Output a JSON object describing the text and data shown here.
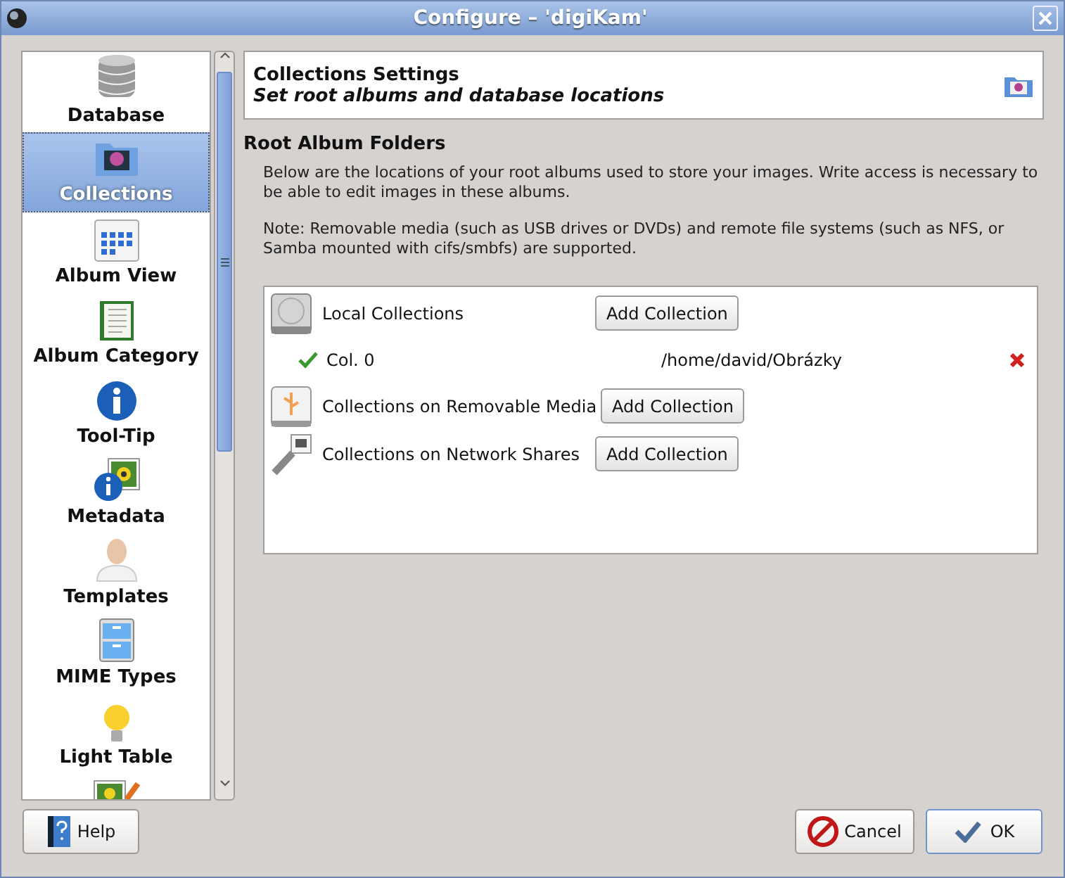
{
  "window": {
    "title": "Configure – 'digiKam'"
  },
  "sidebar": {
    "items": [
      {
        "label": "Database",
        "selected": false
      },
      {
        "label": "Collections",
        "selected": true
      },
      {
        "label": "Album View",
        "selected": false
      },
      {
        "label": "Album Category",
        "selected": false
      },
      {
        "label": "Tool-Tip",
        "selected": false
      },
      {
        "label": "Metadata",
        "selected": false
      },
      {
        "label": "Templates",
        "selected": false
      },
      {
        "label": "MIME Types",
        "selected": false
      },
      {
        "label": "Light Table",
        "selected": false
      },
      {
        "selected": false
      }
    ]
  },
  "header": {
    "title": "Collections Settings",
    "subtitle": "Set root albums and database locations"
  },
  "section": {
    "title": "Root Album Folders",
    "description": "Below are the locations of your root albums used to store your images. Write access is necessary to be able to edit images in these albums.",
    "note": "Note: Removable media (such as USB drives or DVDs) and remote file systems (such as NFS, or Samba mounted with cifs/smbfs) are supported."
  },
  "collections": [
    {
      "kind": "category",
      "label": "Local Collections",
      "button": "Add Collection"
    },
    {
      "kind": "entry",
      "name": "Col. 0",
      "path": "/home/david/Obrázky"
    },
    {
      "kind": "category",
      "label": "Collections on Removable Media",
      "button": "Add Collection"
    },
    {
      "kind": "category",
      "label": "Collections on Network Shares",
      "button": "Add Collection"
    }
  ],
  "buttons": {
    "help": "Help",
    "cancel": "Cancel",
    "ok": "OK"
  }
}
